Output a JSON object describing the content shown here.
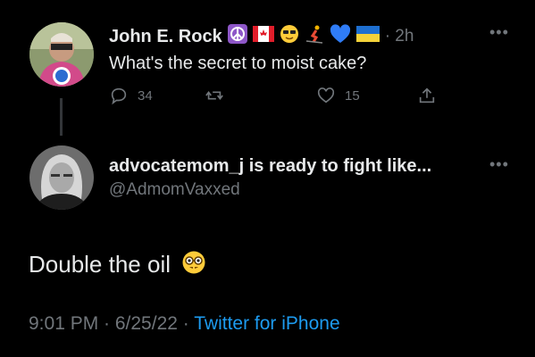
{
  "tweet": {
    "display_name": "John E. Rock",
    "name_emojis": [
      "peace-symbol-emoji",
      "canada-flag-emoji",
      "sunglasses-face-emoji",
      "skier-emoji",
      "blue-heart-emoji",
      "ukraine-flag-emoji"
    ],
    "time": "· 2h",
    "text": "What's the secret to moist cake?",
    "actions": {
      "reply_count": "34",
      "retweet_count": "",
      "like_count": "15"
    }
  },
  "reply": {
    "display_name": "advocatemom_j is ready to fight like...",
    "handle": "@AdmomVaxxed",
    "text": "Double the oil",
    "emoji": "nerd-face-emoji"
  },
  "meta": {
    "timestamp": "9:01 PM · 6/25/22 ·",
    "source": "Twitter for iPhone"
  },
  "colors": {
    "background": "#000000",
    "link": "#1d9bf0",
    "muted": "#71767b",
    "text": "#e7e9ea"
  }
}
